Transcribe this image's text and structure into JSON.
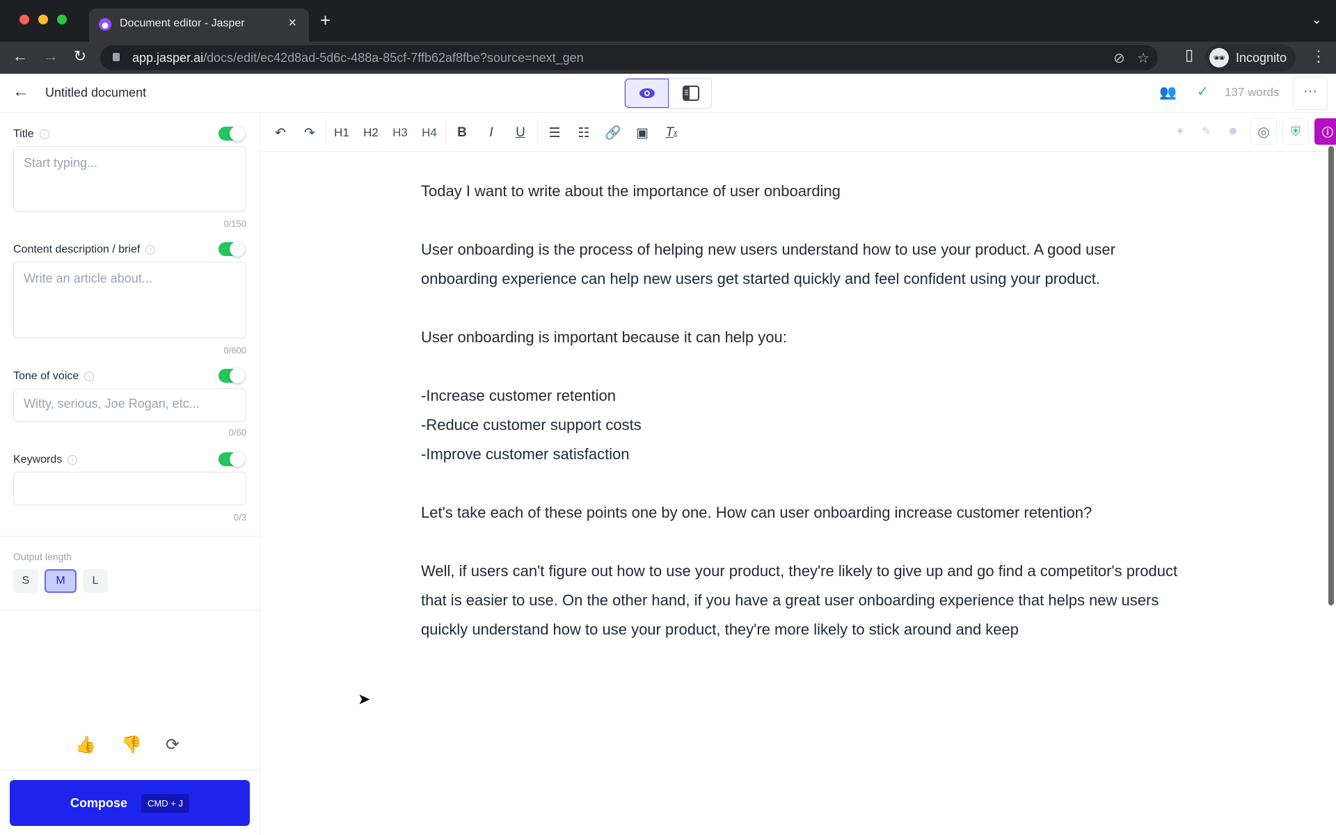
{
  "browser": {
    "tab_title": "Document editor - Jasper",
    "url_host": "app.jasper.ai",
    "url_path": "/docs/edit/ec42d8ad-5d6c-488a-85cf-7ffb62af8fbe?source=next_gen",
    "profile_label": "Incognito",
    "colors": {
      "close": "#ff5f57",
      "minimize": "#febc2e",
      "maximize": "#28c840"
    }
  },
  "header": {
    "doc_title": "Untitled document",
    "word_count": "137 words",
    "view_modes": [
      "preview",
      "sidebar-layout"
    ],
    "active_view": "preview"
  },
  "sidebar": {
    "fields": [
      {
        "label": "Title",
        "placeholder": "Start typing...",
        "count": "0/150",
        "enabled": true
      },
      {
        "label": "Content description / brief",
        "placeholder": "Write an article about...",
        "count": "0/600",
        "enabled": true
      },
      {
        "label": "Tone of voice",
        "placeholder": "Witty, serious, Joe Rogan, etc...",
        "count": "0/60",
        "enabled": true
      },
      {
        "label": "Keywords",
        "placeholder": "",
        "count": "0/3",
        "enabled": true
      }
    ],
    "output_length": {
      "label": "Output length",
      "options": [
        "S",
        "M",
        "L"
      ],
      "selected": "M"
    },
    "compose": {
      "label": "Compose",
      "shortcut": "CMD + J",
      "color": "#1d24ee"
    }
  },
  "toolbar": {
    "items": [
      "undo",
      "redo",
      "H1",
      "H2",
      "H3",
      "H4",
      "bold",
      "italic",
      "underline",
      "ordered-list",
      "bullet-list",
      "link",
      "image",
      "clear-format"
    ],
    "labels": {
      "h1": "H1",
      "h2": "H2",
      "h3": "H3",
      "h4": "H4",
      "bold": "B",
      "italic": "I",
      "underline": "U"
    }
  },
  "document": {
    "paragraphs": [
      "Today I want to write about the importance of user onboarding",
      "",
      "User onboarding is the process of helping new users understand how to use your product. A good user onboarding experience can help new users get started quickly and feel confident using your product.",
      "",
      "User onboarding is important because it can help you:",
      "",
      "-Increase customer retention",
      "-Reduce customer support costs",
      "-Improve customer satisfaction",
      "",
      "Let's take each of these points one by one. How can user onboarding increase customer retention?",
      "",
      "Well, if users can't figure out how to use your product, they're likely to give up and go find a competitor's product that is easier to use. On the other hand, if you have a great user onboarding experience that helps new users quickly understand how to use your product, they're more likely to stick around and keep"
    ]
  }
}
